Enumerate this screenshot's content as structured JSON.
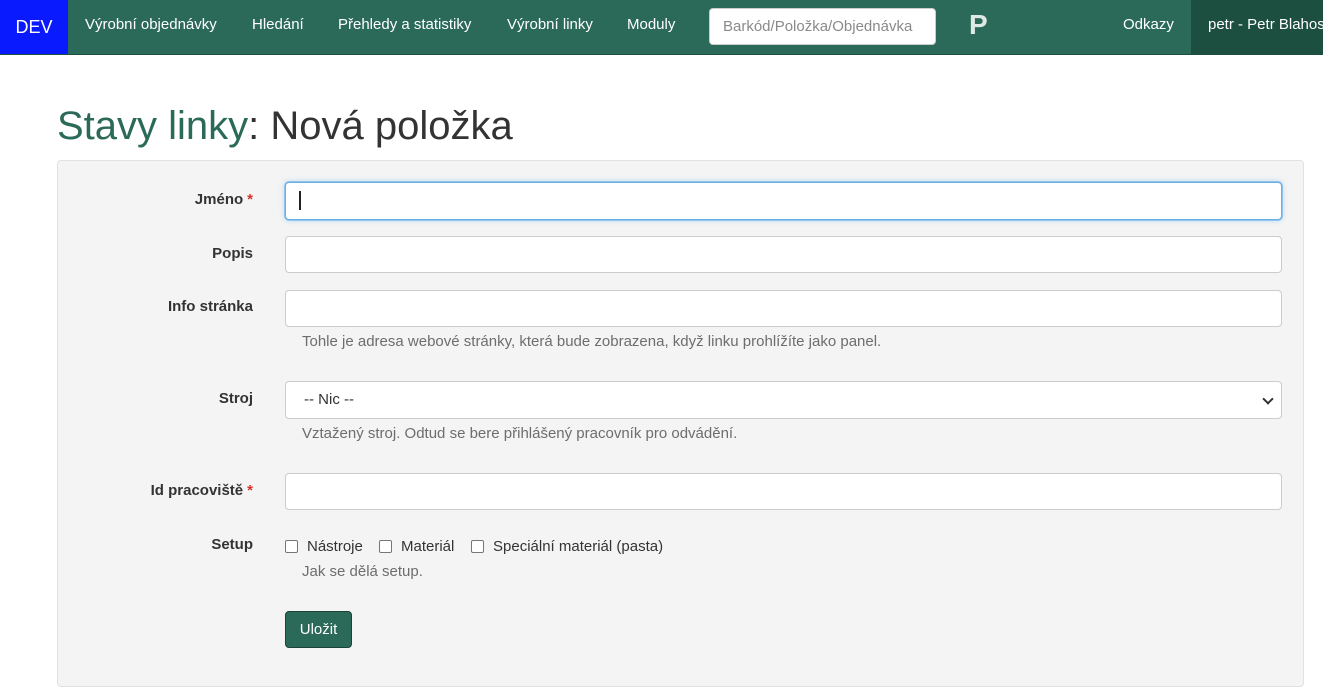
{
  "navbar": {
    "env_badge": "DEV",
    "items": [
      "Výrobní objednávky",
      "Hledání",
      "Přehledy a statistiky",
      "Výrobní linky",
      "Moduly"
    ],
    "search_placeholder": "Barkód/Položka/Objednávka",
    "brand": "P",
    "links": "Odkazy",
    "user": "petr - Petr Blahos"
  },
  "page": {
    "title_link": "Stavy linky",
    "title_suffix": ": Nová položka"
  },
  "form": {
    "name": {
      "label": "Jméno",
      "required": "*",
      "value": ""
    },
    "description": {
      "label": "Popis",
      "value": ""
    },
    "info_page": {
      "label": "Info stránka",
      "value": "",
      "help": "Tohle je adresa webové stránky, která bude zobrazena, když linku prohlížíte jako panel."
    },
    "machine": {
      "label": "Stroj",
      "selected": "-- Nic --",
      "help": "Vztažený stroj. Odtud se bere přihlášený pracovník pro odvádění."
    },
    "workplace_id": {
      "label": "Id pracoviště",
      "required": "*",
      "value": ""
    },
    "setup": {
      "label": "Setup",
      "options": [
        "Nástroje",
        "Materiál",
        "Speciální materiál (pasta)"
      ],
      "help": "Jak se dělá setup."
    },
    "save_label": "Uložit"
  },
  "colors": {
    "navbar": "#2b6a58",
    "env_badge": "#0a1aff",
    "user_menu": "#1d4f41",
    "required": "#d9302c",
    "focus": "#66afe9"
  }
}
